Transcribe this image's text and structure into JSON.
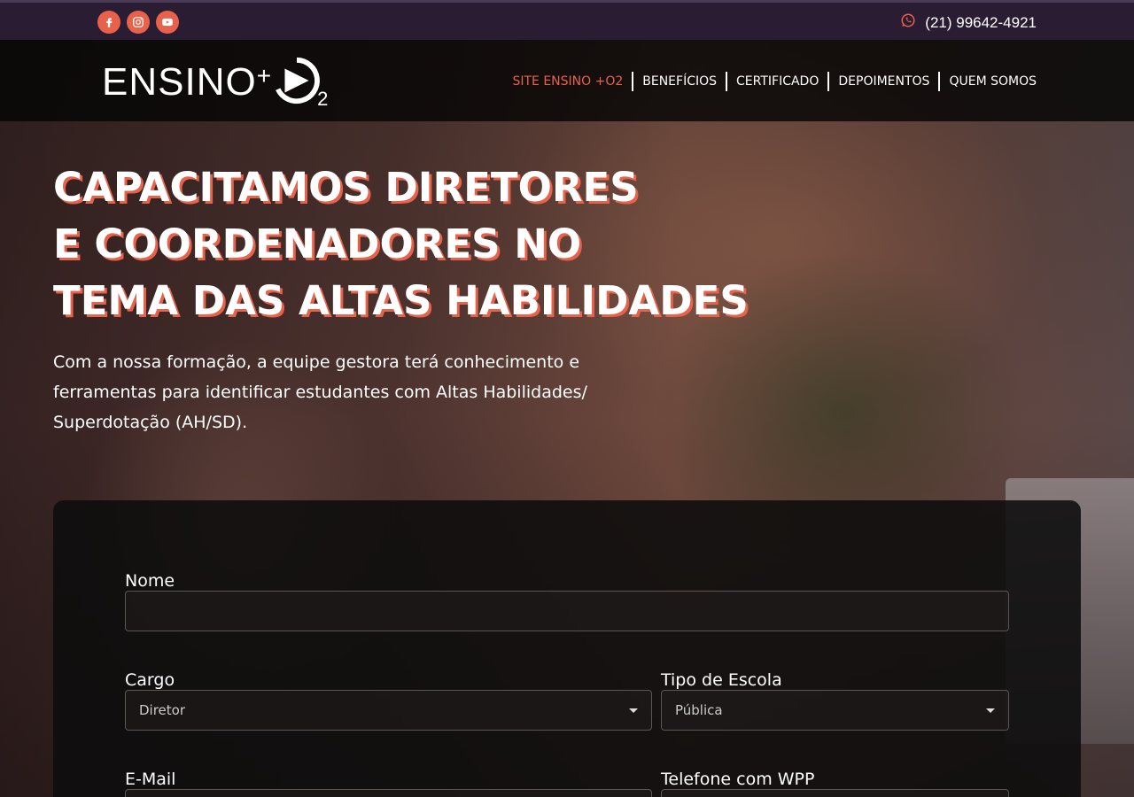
{
  "topbar": {
    "social": [
      {
        "icon": "facebook-icon"
      },
      {
        "icon": "instagram-icon"
      },
      {
        "icon": "youtube-icon"
      }
    ],
    "phone": "(21) 99642-4921",
    "phone_icon": "whatsapp-icon"
  },
  "logo": {
    "text": "ENSINO",
    "plus": "+",
    "sub": "2"
  },
  "nav": {
    "items": [
      "SITE ENSINO +O2",
      "BENEFÍCIOS",
      "CERTIFICADO",
      "DEPOIMENTOS",
      "QUEM SOMOS"
    ]
  },
  "hero": {
    "title_lines": [
      "CAPACITAMOS DIRETORES",
      "E COORDENADORES NO",
      "TEMA DAS ALTAS HABILIDADES"
    ],
    "text": "Com a nossa formação, a equipe gestora terá conhecimento e ferramentas para identificar estudantes com Altas Habilidades/ Superdotação (AH/SD)."
  },
  "form": {
    "nome_label": "Nome",
    "nome_value": "",
    "cargo_label": "Cargo",
    "cargo_value": "Diretor",
    "tipo_label": "Tipo de Escola",
    "tipo_value": "Pública",
    "email_label": "E-Mail",
    "telefone_label": "Telefone com WPP"
  },
  "colors": {
    "accent": "#e8614a",
    "topbar": "#2a1d33"
  }
}
